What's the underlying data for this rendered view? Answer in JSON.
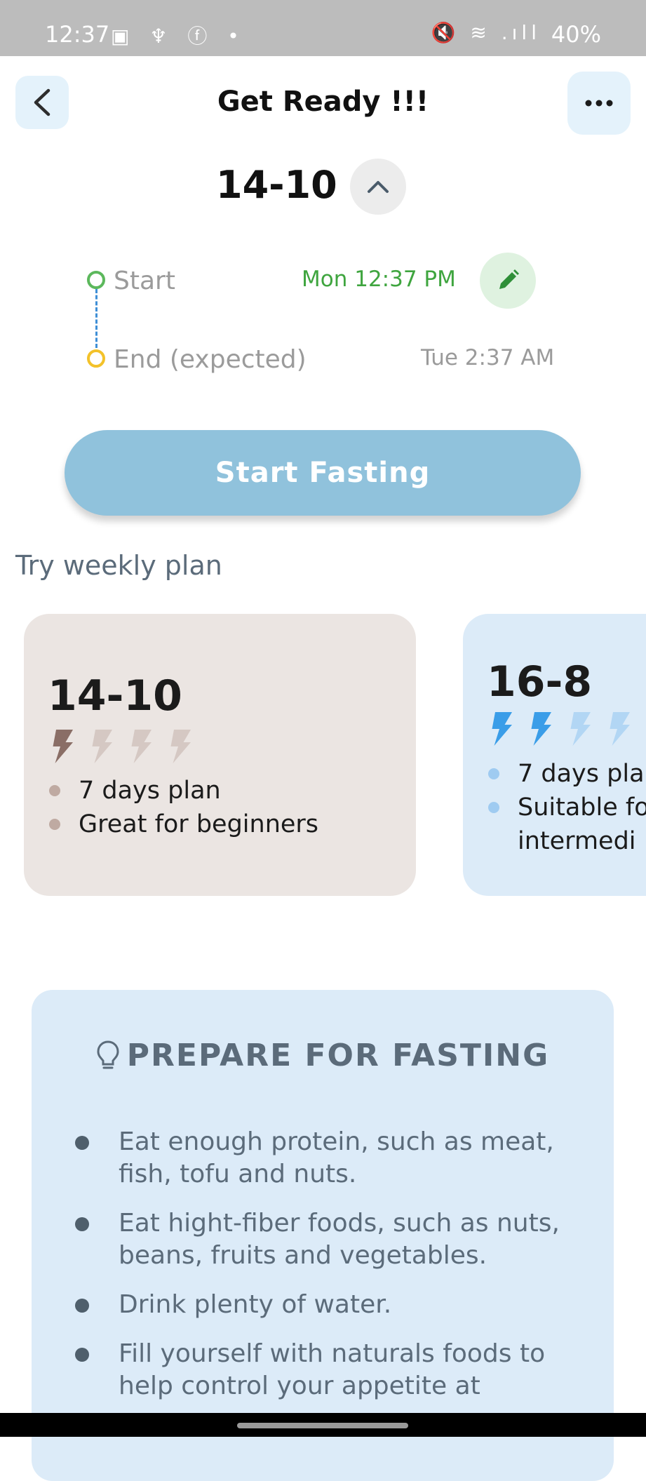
{
  "status_bar": {
    "time": "12:37",
    "left_icons": "▣ ♆ ⓕ •",
    "right_icons": "🔇 ≋ .ıll",
    "battery": "40%"
  },
  "header": {
    "title": "Get Ready !!!",
    "back_icon": "chevron-left-icon",
    "more_icon": "more-horizontal-icon"
  },
  "plan_selector": {
    "plan": "14-10",
    "toggle_icon": "chevron-up-icon"
  },
  "schedule": {
    "start_label": "Start",
    "start_time": "Mon 12:37 PM",
    "end_label": "End (expected)",
    "end_time": "Tue 2:37 AM",
    "edit_icon": "pencil-icon"
  },
  "start_button": {
    "label": "Start Fasting"
  },
  "weekly_section": {
    "label": "Try weekly plan"
  },
  "plan_cards": [
    {
      "title": "14-10",
      "level": 1,
      "level_max": 4,
      "bullets": [
        "7 days plan",
        "Great for beginners"
      ],
      "accent": "#8a6e66",
      "accent_light": "#d5c8c3"
    },
    {
      "title": "16-8",
      "level": 2,
      "level_max": 4,
      "bullets": [
        "7 days pla",
        "Suitable fo intermedi"
      ],
      "accent": "#3a9de8",
      "accent_light": "#b2d6f4"
    }
  ],
  "prepare": {
    "icon": "lightbulb-icon",
    "title": "PREPARE FOR FASTING",
    "tips": [
      "Eat enough protein, such as meat, fish, tofu and nuts.",
      "Eat hight-fiber foods, such as nuts, beans, fruits and vegetables.",
      "Drink plenty of water.",
      "Fill yourself with naturals foods to help control your appetite at"
    ]
  },
  "colors": {
    "primary_button": "#90c2dc",
    "start_green": "#3fa53f",
    "end_yellow": "#f3c22a",
    "icon_bg": "#e4f2fb"
  }
}
